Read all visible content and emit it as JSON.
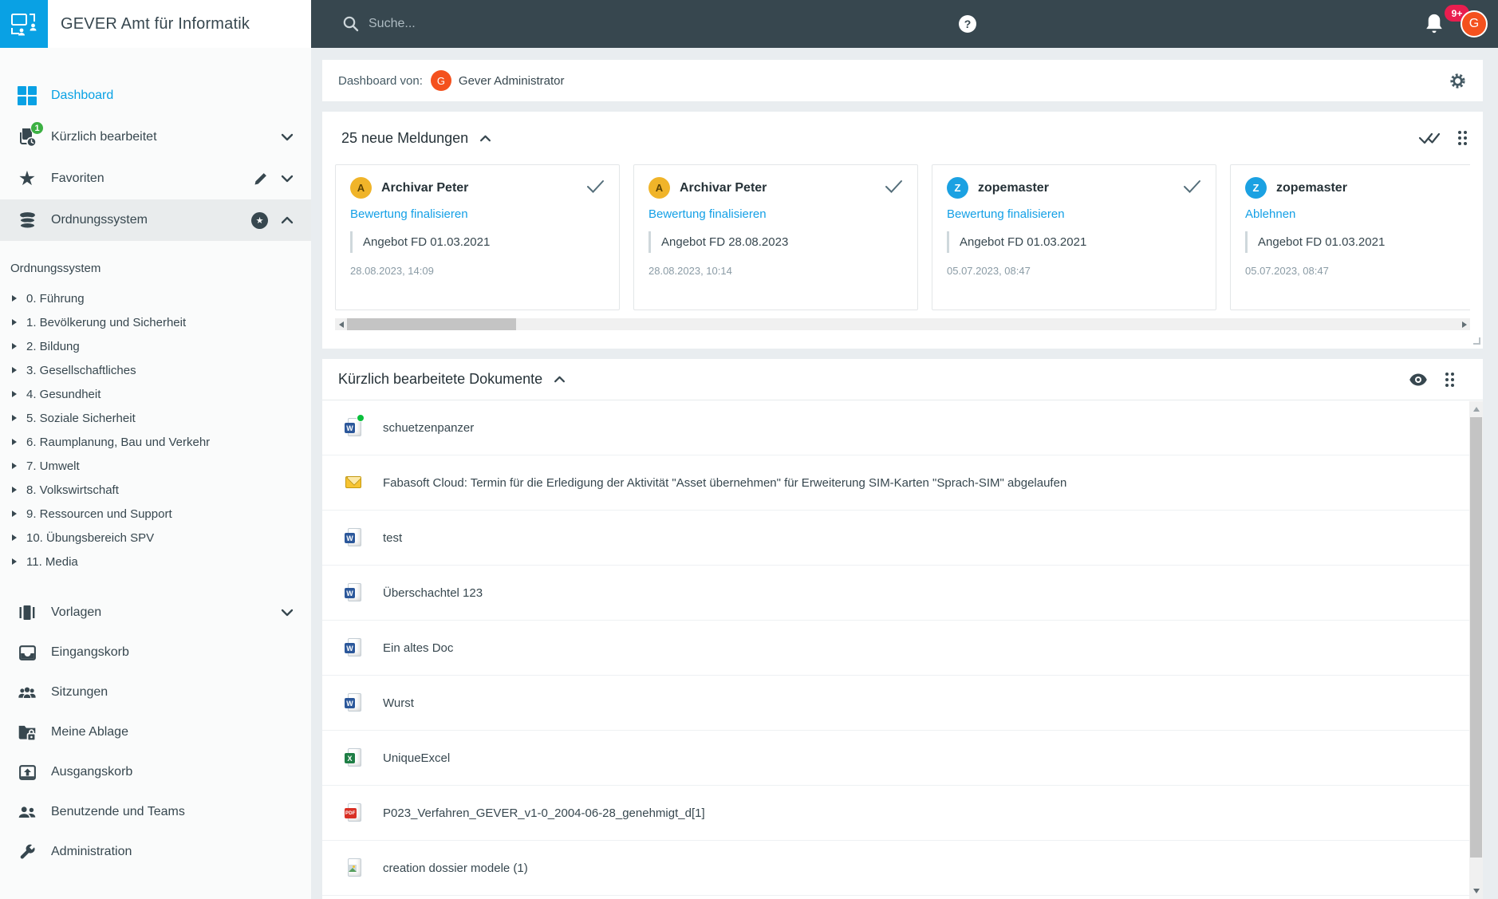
{
  "header": {
    "app_title": "GEVER Amt für Informatik",
    "search_placeholder": "Suche...",
    "notification_badge": "9+",
    "avatar_letter": "G"
  },
  "dashboard_bar": {
    "label": "Dashboard von:",
    "user_avatar_letter": "G",
    "user_name": "Gever Administrator"
  },
  "sidebar": {
    "items_top": [
      {
        "label": "Dashboard"
      },
      {
        "label": "Kürzlich bearbeitet",
        "badge": "1"
      },
      {
        "label": "Favoriten"
      },
      {
        "label": "Ordnungssystem"
      }
    ],
    "tree": {
      "title": "Ordnungssystem",
      "items": [
        "0. Führung",
        "1. Bevölkerung und Sicherheit",
        "2. Bildung",
        "3. Gesellschaftliches",
        "4. Gesundheit",
        "5. Soziale Sicherheit",
        "6. Raumplanung, Bau und Verkehr",
        "7. Umwelt",
        "8. Volkswirtschaft",
        "9. Ressourcen und Support",
        "10. Übungsbereich SPV",
        "11. Media"
      ]
    },
    "items_bottom": [
      {
        "label": "Vorlagen"
      },
      {
        "label": "Eingangskorb"
      },
      {
        "label": "Sitzungen"
      },
      {
        "label": "Meine Ablage"
      },
      {
        "label": "Ausgangskorb"
      },
      {
        "label": "Benutzende und Teams"
      },
      {
        "label": "Administration"
      }
    ]
  },
  "meldungen": {
    "title": "25 neue Meldungen",
    "cards": [
      {
        "avatar_letter": "A",
        "name": "Archivar Peter",
        "action": "Bewertung finalisieren",
        "subject": "Angebot FD 01.03.2021",
        "timestamp": "28.08.2023, 14:09"
      },
      {
        "avatar_letter": "A",
        "name": "Archivar Peter",
        "action": "Bewertung finalisieren",
        "subject": "Angebot FD 28.08.2023",
        "timestamp": "28.08.2023, 10:14"
      },
      {
        "avatar_letter": "Z",
        "name": "zopemaster",
        "action": "Bewertung finalisieren",
        "subject": "Angebot FD 01.03.2021",
        "timestamp": "05.07.2023, 08:47"
      },
      {
        "avatar_letter": "Z",
        "name": "zopemaster",
        "action": "Ablehnen",
        "subject": "Angebot FD 01.03.2021",
        "timestamp": "05.07.2023, 08:47"
      }
    ]
  },
  "documents": {
    "title": "Kürzlich bearbeitete Dokumente",
    "icon_labels": {
      "word": "W",
      "excel": "X",
      "pdf": "PDF"
    },
    "items": [
      {
        "name": "schuetzenpanzer",
        "type": "word"
      },
      {
        "name": "Fabasoft Cloud: Termin für die Erledigung der Aktivität \"Asset übernehmen\" für Erweiterung SIM-Karten \"Sprach-SIM\" abgelaufen",
        "type": "email"
      },
      {
        "name": "test",
        "type": "word"
      },
      {
        "name": "Überschachtel 123",
        "type": "word"
      },
      {
        "name": "Ein altes Doc",
        "type": "word"
      },
      {
        "name": "Wurst",
        "type": "word"
      },
      {
        "name": "UniqueExcel",
        "type": "excel"
      },
      {
        "name": "P023_Verfahren_GEVER_v1-0_2004-06-28_genehmigt_d[1]",
        "type": "pdf"
      },
      {
        "name": "creation dossier modele (1)",
        "type": "image"
      }
    ]
  },
  "colors": {
    "accent_blue": "#09a1e4",
    "header_dark": "#37474f",
    "avatar_orange": "#f4511e",
    "avatar_amber": "#f0b429",
    "avatar_blue": "#1ba1e2",
    "badge_pink": "#e91e4f",
    "badge_green": "#3cb043",
    "unread_green": "#0abf3c"
  }
}
